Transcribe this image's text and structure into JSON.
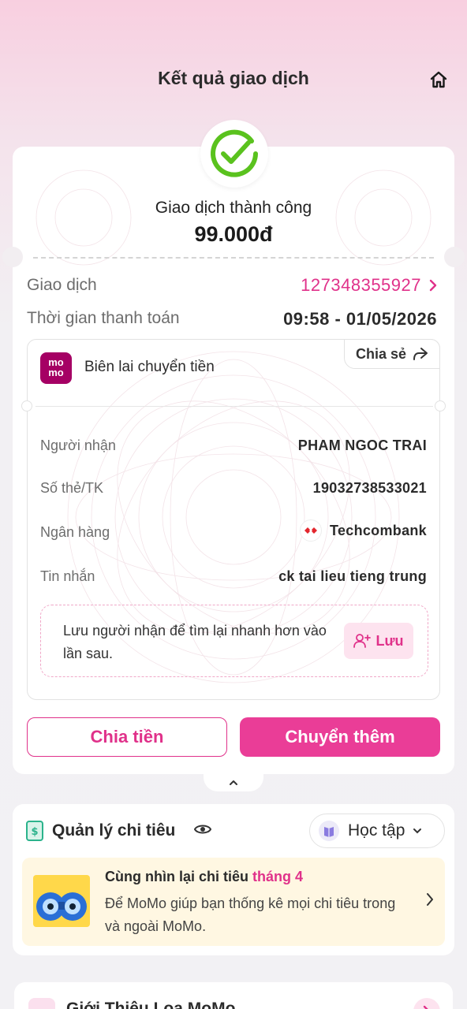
{
  "header": {
    "title": "Kết quả giao dịch"
  },
  "result": {
    "status": "Giao dịch thành công",
    "amount": "99.000đ",
    "transaction_label": "Giao dịch",
    "transaction_id": "127348355927",
    "time_label": "Thời gian thanh toán",
    "time_value": "09:58 - 01/05/2026"
  },
  "receipt": {
    "logo_text_1": "mo",
    "logo_text_2": "mo",
    "title": "Biên lai chuyển tiền",
    "share_label": "Chia sẻ",
    "rows": [
      {
        "label": "Người nhận",
        "value": "PHAM NGOC TRAI"
      },
      {
        "label": "Số thẻ/TK",
        "value": "19032738533021"
      },
      {
        "label": "Ngân hàng",
        "value": "Techcombank"
      },
      {
        "label": "Tin nhắn",
        "value": "ck tai lieu tieng trung"
      }
    ],
    "save_prompt": "Lưu người nhận để tìm lại nhanh hơn vào lần sau.",
    "save_button": "Lưu"
  },
  "actions": {
    "split_label": "Chia tiền",
    "transfer_more_label": "Chuyển thêm"
  },
  "spending": {
    "title": "Quản lý chi tiêu",
    "category": "Học tập",
    "promo_title": "Cùng nhìn lại chi tiêu ",
    "promo_title_accent": "tháng 4",
    "promo_desc": "Để MoMo giúp bạn thống kê mọi chi tiêu trong và ngoài MoMo."
  },
  "intro": {
    "title": "Giới Thiệu Loa MoMo"
  },
  "colors": {
    "brand_pink": "#e0318a",
    "success_green": "#5ac21e",
    "momo_purple": "#a50064"
  },
  "icons": {
    "home": "home-icon",
    "success": "check-circle-icon",
    "share": "share-arrow-icon",
    "chevron_right": "chevron-right-icon",
    "chevron_up": "chevron-up-icon",
    "add_user": "add-user-icon",
    "eye": "eye-icon",
    "wallet": "wallet-icon",
    "book": "book-icon"
  }
}
